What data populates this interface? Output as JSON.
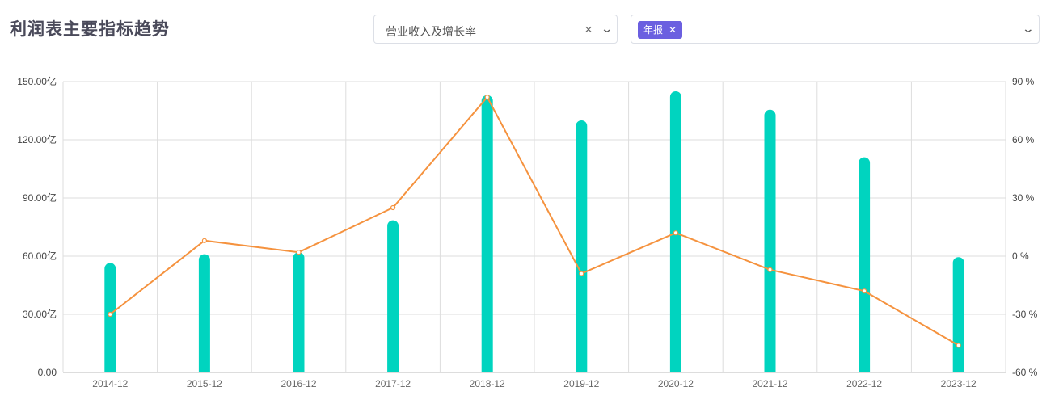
{
  "header": {
    "title": "利润表主要指标趋势"
  },
  "filters": {
    "indicator_select": {
      "value": "营业收入及增长率"
    },
    "period_select": {
      "tags": [
        "年报"
      ]
    }
  },
  "icons": {
    "clear": "close-icon",
    "dropdown": "chevron-down-icon",
    "tag_close": "close-icon"
  },
  "chart_data": {
    "type": "bar",
    "categories": [
      "2014-12",
      "2015-12",
      "2016-12",
      "2017-12",
      "2018-12",
      "2019-12",
      "2020-12",
      "2021-12",
      "2022-12",
      "2023-12"
    ],
    "series": [
      {
        "type": "bar",
        "axis": "left",
        "color": "#00d4bf",
        "values": [
          56.5,
          61.0,
          62.0,
          78.5,
          143.0,
          130.0,
          145.0,
          135.5,
          111.0,
          59.5
        ]
      },
      {
        "type": "line",
        "axis": "right",
        "color": "#f5923e",
        "values": [
          -30,
          8,
          2,
          25,
          82,
          -9,
          12,
          -7,
          -18,
          -46
        ]
      }
    ],
    "y_left": {
      "ylim": [
        0,
        150
      ],
      "ticks": [
        "0.00",
        "30.00亿",
        "60.00亿",
        "90.00亿",
        "120.00亿",
        "150.00亿"
      ]
    },
    "y_right": {
      "ylim": [
        -60,
        90
      ],
      "ticks": [
        "-60 %",
        "-30 %",
        "0 %",
        "30 %",
        "60 %",
        "90 %"
      ]
    },
    "grid": true
  }
}
